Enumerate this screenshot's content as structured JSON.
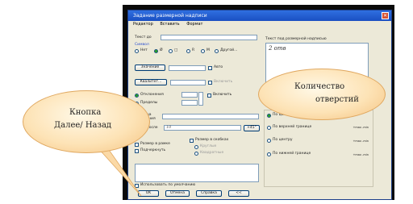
{
  "window": {
    "title": "Задание размерной надписи",
    "close_glyph": "✕"
  },
  "menu": [
    "Редактор",
    "Вставить",
    "Формат"
  ],
  "left": {
    "text_before_label": "Текст до",
    "symbol_label": "Символ",
    "symbol_options": [
      "Нет",
      "Ø",
      "□",
      "R",
      "M",
      "Другой..."
    ],
    "value_button": "Значение",
    "auto_label": "Авто",
    "quality_button": "Квалитет...",
    "include_label_1": "Включить",
    "deviations_label": "Отклонения",
    "limits_label": "Пределы",
    "include_label_2": "Включить",
    "unit_label": "Единица измерения",
    "text_after_label": "Текст после",
    "text_after_value": "10",
    "angle_button": "+45°",
    "size_frame_label": "Размер в рамке",
    "underline_label": "Подчеркнуть",
    "brackets_label": "Размер в скобках",
    "round_label": "Круглые",
    "square_label": "Квадратные",
    "use_default_label": "Использовать по умолчанию"
  },
  "right": {
    "under_line_label": "Текст под размерной надписью",
    "under_line_value": "2 отв",
    "placement_label": "Выр",
    "placement_options": [
      "По центру",
      "По верхней границе",
      "По центру",
      "По нижней границе"
    ],
    "tolerance_marks": [
      "+max -min",
      "+max -min",
      "+max -min"
    ]
  },
  "buttons": {
    "ok": "OK",
    "cancel": "Отмена",
    "help": "Справка",
    "back": "<<"
  },
  "callouts": {
    "holes": [
      "Количество",
      "отверстий"
    ],
    "nav": [
      "Кнопка",
      "Далее/ Назад"
    ]
  }
}
